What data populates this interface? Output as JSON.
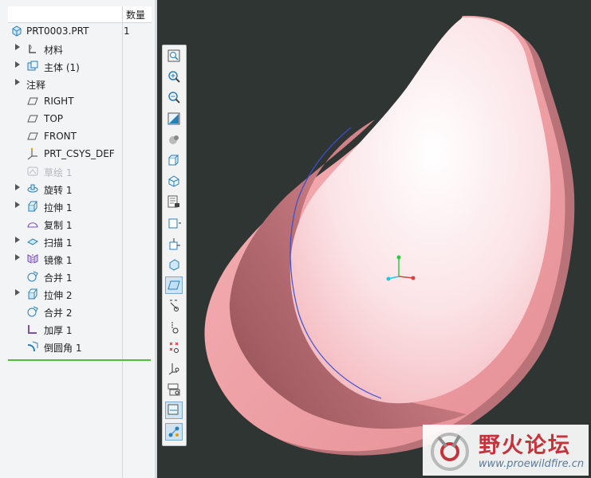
{
  "tree": {
    "column_header": "数量",
    "items": [
      {
        "label": "PRT0003.PRT",
        "count": "1",
        "icon": "part-icon",
        "expand": false
      },
      {
        "label": "材料",
        "icon": "material-icon",
        "expand": true
      },
      {
        "label": "主体 (1)",
        "icon": "body-icon",
        "expand": true
      },
      {
        "label": "注释",
        "icon": "",
        "expand": true
      },
      {
        "label": "RIGHT",
        "icon": "datum-plane-icon",
        "expand": false
      },
      {
        "label": "TOP",
        "icon": "datum-plane-icon",
        "expand": false
      },
      {
        "label": "FRONT",
        "icon": "datum-plane-icon",
        "expand": false
      },
      {
        "label": "PRT_CSYS_DEF",
        "icon": "csys-icon",
        "expand": false
      },
      {
        "label": "草绘 1",
        "icon": "sketch-icon",
        "expand": false,
        "dim": true
      },
      {
        "label": "旋转 1",
        "icon": "revolve-icon",
        "expand": true
      },
      {
        "label": "拉伸 1",
        "icon": "extrude-icon",
        "expand": true
      },
      {
        "label": "复制 1",
        "icon": "copy-icon",
        "expand": false
      },
      {
        "label": "扫描 1",
        "icon": "sweep-icon",
        "expand": true
      },
      {
        "label": "镜像 1",
        "icon": "mirror-icon",
        "expand": true
      },
      {
        "label": "合并 1",
        "icon": "merge-icon",
        "expand": false
      },
      {
        "label": "拉伸 2",
        "icon": "extrude-icon",
        "expand": true
      },
      {
        "label": "合并 2",
        "icon": "merge-icon",
        "expand": false
      },
      {
        "label": "加厚 1",
        "icon": "thicken-icon",
        "expand": false
      },
      {
        "label": "倒圆角 1",
        "icon": "round-icon",
        "expand": false
      }
    ]
  },
  "toolbar": {
    "buttons": [
      "refit-icon",
      "zoom-in-icon",
      "zoom-out-icon",
      "repaint-icon",
      "render-icon",
      "display-style-icon",
      "saved-orientations-icon",
      "view-manager-icon",
      "perspective-icon",
      "spin-center-icon",
      "annotation-display-icon",
      "plane-display-icon",
      "axis-display-icon",
      "point-display-icon",
      "csys-display-icon",
      "point-tag-display-icon",
      "model-tree-filter-icon",
      "datum-display-filter-icon",
      "appearance-icon"
    ]
  },
  "watermark": {
    "title": "野火论坛",
    "url": "www.proewildfire.cn"
  },
  "colors": {
    "viewport_bg": "#2f3533",
    "shell_pink": "#f2a6ab",
    "selection_green": "#4fbf3a"
  }
}
